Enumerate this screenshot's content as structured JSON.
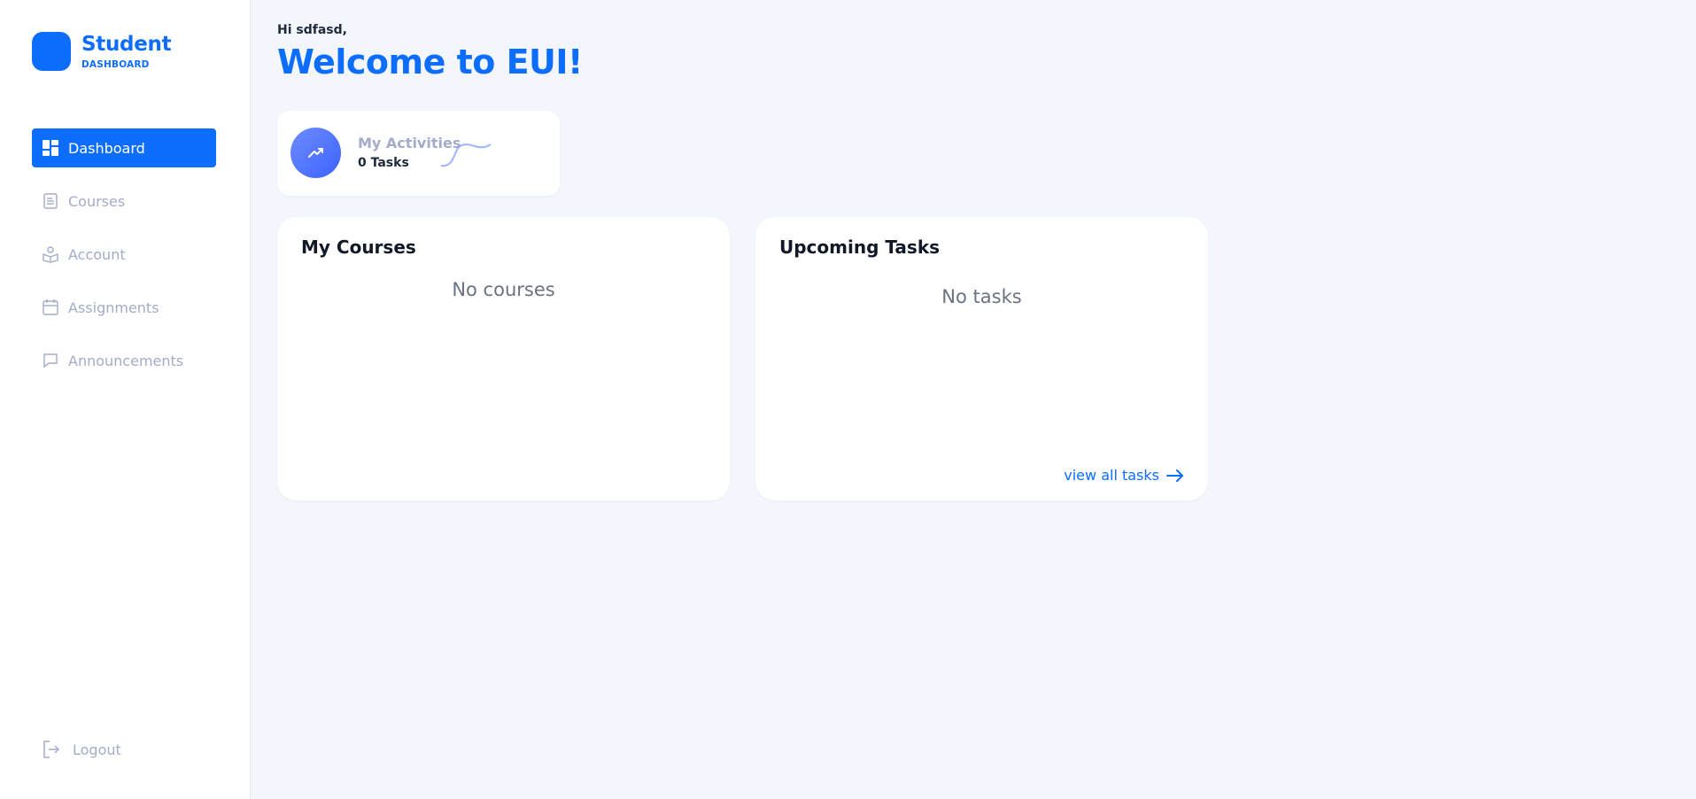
{
  "brand": {
    "title": "Student",
    "subtitle": "DASHBOARD",
    "color": "#0d6efd"
  },
  "sidebar": {
    "items": [
      {
        "label": "Dashboard",
        "icon": "grid-icon",
        "active": true
      },
      {
        "label": "Courses",
        "icon": "document-icon",
        "active": false
      },
      {
        "label": "Account",
        "icon": "user-book-icon",
        "active": false
      },
      {
        "label": "Assignments",
        "icon": "calendar-icon",
        "active": false
      },
      {
        "label": "Announcements",
        "icon": "chat-bubble-icon",
        "active": false
      }
    ],
    "logout_label": "Logout"
  },
  "header": {
    "greeting": "Hi sdfasd,",
    "welcome": "Welcome to EUI!"
  },
  "activities": {
    "title": "My Activities",
    "count": "0 Tasks",
    "icon": "trend-up-icon"
  },
  "courses": {
    "title": "My Courses",
    "empty": "No courses"
  },
  "tasks": {
    "title": "Upcoming Tasks",
    "empty": "No tasks",
    "view_all": "view all tasks"
  },
  "colors": {
    "accent": "#0d6efd",
    "muted": "#a3acc8",
    "background": "#f3f6fd"
  }
}
